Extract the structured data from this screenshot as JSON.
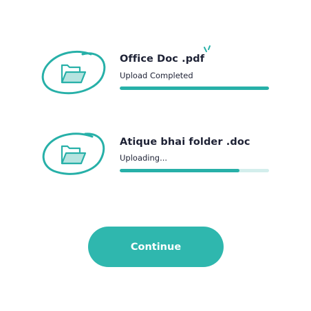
{
  "accent_color": "#2fb7ae",
  "progress_track_color": "#d3eeec",
  "uploads": [
    {
      "file_name": "Office Doc .pdf",
      "status": "Upload Completed",
      "progress": 1.0,
      "icon": "folder-open-icon"
    },
    {
      "file_name": "Atique bhai folder .doc",
      "status": "Uploading...",
      "progress": 0.8,
      "icon": "folder-open-icon"
    }
  ],
  "continue_label": "Continue"
}
